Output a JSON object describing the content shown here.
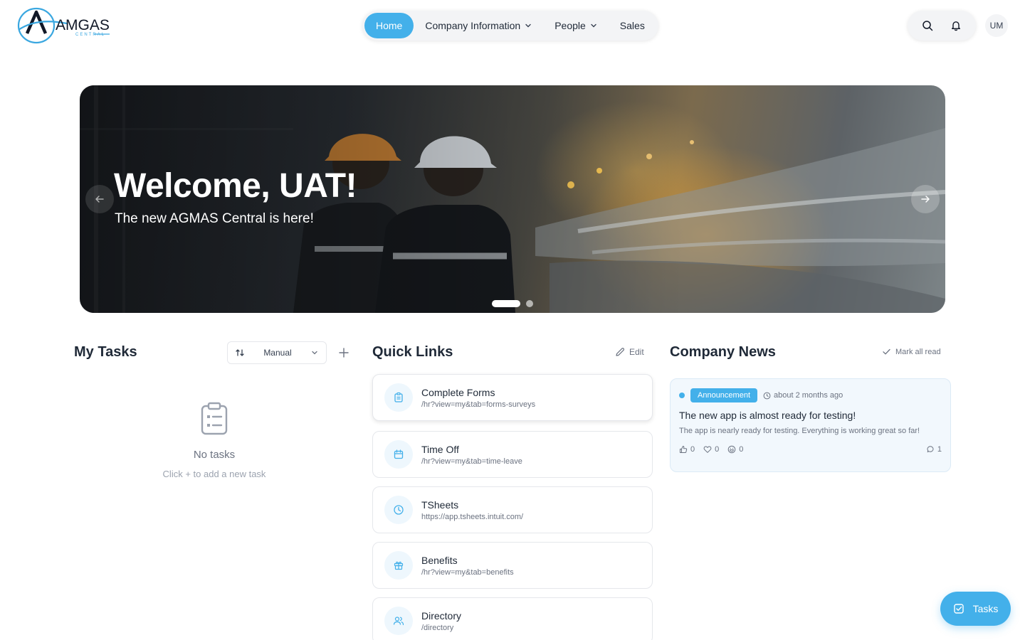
{
  "brand": {
    "logo_text": "AMGAS",
    "logo_subtext": "CENTRAL",
    "primary_color": "#43b0ea"
  },
  "nav": {
    "items": [
      {
        "label": "Home",
        "active": true
      },
      {
        "label": "Company Information",
        "has_dropdown": true
      },
      {
        "label": "People",
        "has_dropdown": true
      },
      {
        "label": "Sales"
      }
    ]
  },
  "header": {
    "search_icon": "search-icon",
    "notifications_icon": "bell-icon",
    "avatar_initials": "UM"
  },
  "hero": {
    "title": "Welcome, UAT!",
    "subtitle": "The new AGMAS Central is here!",
    "slide_count": 2,
    "active_slide": 1
  },
  "my_tasks": {
    "title": "My Tasks",
    "sort_label": "Manual",
    "empty_title": "No tasks",
    "empty_subtitle": "Click + to add a new task"
  },
  "quick_links": {
    "title": "Quick Links",
    "edit_label": "Edit",
    "items": [
      {
        "title": "Complete Forms",
        "url": "/hr?view=my&tab=forms-surveys",
        "icon": "clipboard-icon"
      },
      {
        "title": "Time Off",
        "url": "/hr?view=my&tab=time-leave",
        "icon": "calendar-icon"
      },
      {
        "title": "TSheets",
        "url": "https://app.tsheets.intuit.com/",
        "icon": "clock-icon"
      },
      {
        "title": "Benefits",
        "url": "/hr?view=my&tab=benefits",
        "icon": "gift-icon"
      },
      {
        "title": "Directory",
        "url": "/directory",
        "icon": "users-icon"
      }
    ]
  },
  "company_news": {
    "title": "Company News",
    "mark_all_label": "Mark all read",
    "items": [
      {
        "badge": "Announcement",
        "time": "about 2 months ago",
        "title": "The new app is almost ready for testing!",
        "body": "The app is nearly ready for testing. Everything is working great so far!",
        "likes": "0",
        "hearts": "0",
        "laughs": "0",
        "comments": "1"
      }
    ]
  },
  "fab": {
    "label": "Tasks"
  }
}
